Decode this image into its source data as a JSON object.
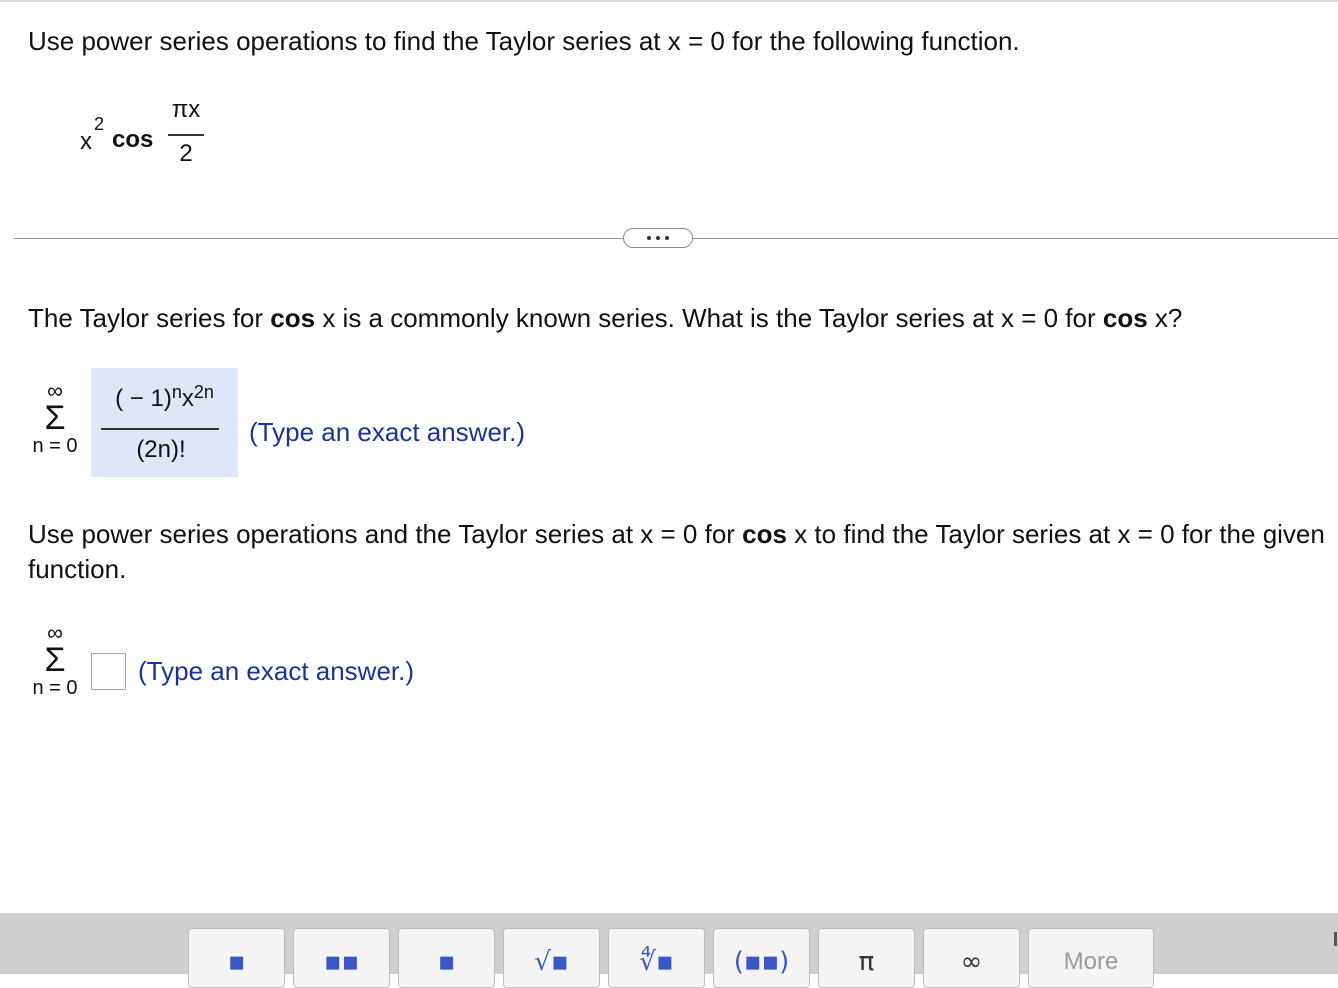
{
  "question": "Use power series operations to find the Taylor series at x = 0 for the following function.",
  "function": {
    "base": "x",
    "exponent": "2",
    "name": "cos",
    "numerator": "πx",
    "denominator": "2"
  },
  "expand_label": "•••",
  "part1": {
    "prefix": "The Taylor series for ",
    "fn_a": "cos",
    "mid": " x is a commonly known series. What is the Taylor series at x = 0 for ",
    "fn_b": "cos",
    "suffix": " x?",
    "sum_upper": "∞",
    "sum_symbol": "Σ",
    "sum_lower": "n = 0",
    "answer": {
      "num_base": "( − 1)",
      "num_exp1": "n",
      "num_x": "x",
      "num_exp2": "2n",
      "denominator": "(2n)!"
    },
    "hint": "(Type an exact answer.)"
  },
  "part2": {
    "prefix": "Use power series operations and the Taylor series at x = 0 for ",
    "fn": "cos",
    "suffix": " x to find the Taylor series at x = 0 for the given function.",
    "sum_upper": "∞",
    "sum_symbol": "Σ",
    "sum_lower": "n = 0",
    "input_value": "",
    "hint": "(Type an exact answer.)"
  },
  "toolbar": {
    "buttons": [
      {
        "name": "fraction-button",
        "icon": "fraction-icon",
        "glyph": "▪"
      },
      {
        "name": "mixed-number-button",
        "icon": "mixed-number-icon",
        "glyph": "▪▪"
      },
      {
        "name": "exponent-button",
        "icon": "exponent-icon",
        "glyph": "▪"
      },
      {
        "name": "square-root-button",
        "icon": "sqrt-icon",
        "glyph": "√▪"
      },
      {
        "name": "nth-root-button",
        "icon": "nth-root-icon",
        "glyph": "∜▪"
      },
      {
        "name": "parentheses-button",
        "icon": "parentheses-icon",
        "glyph": "(▪▪)"
      },
      {
        "name": "pi-button",
        "icon": "pi-icon",
        "glyph": "π"
      },
      {
        "name": "infinity-button",
        "icon": "infinity-icon",
        "glyph": "∞"
      },
      {
        "name": "more-button",
        "icon": "more-label",
        "glyph": "More"
      }
    ]
  }
}
